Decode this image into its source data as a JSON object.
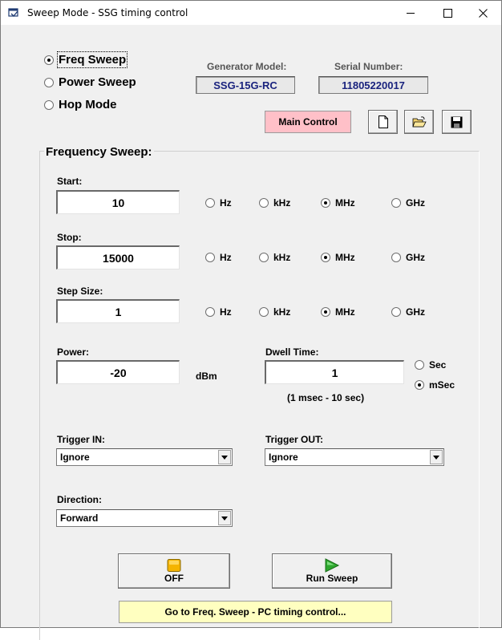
{
  "window": {
    "title": "Sweep Mode - SSG timing control"
  },
  "modes": [
    {
      "label": "Freq Sweep",
      "selected": true
    },
    {
      "label": "Power Sweep",
      "selected": false
    },
    {
      "label": "Hop Mode",
      "selected": false
    }
  ],
  "generator": {
    "model_label": "Generator Model:",
    "model_value": "SSG-15G-RC",
    "serial_label": "Serial Number:",
    "serial_value": "11805220017"
  },
  "toolbar": {
    "main_control_label": "Main Control",
    "main_control_color": "#ffc0c8"
  },
  "group": {
    "title": "Frequency Sweep:"
  },
  "start": {
    "label": "Start:",
    "value": "10",
    "unit_selected": "MHz"
  },
  "stop": {
    "label": "Stop:",
    "value": "15000",
    "unit_selected": "MHz"
  },
  "step": {
    "label": "Step Size:",
    "value": "1",
    "unit_selected": "MHz"
  },
  "units": [
    "Hz",
    "kHz",
    "MHz",
    "GHz"
  ],
  "power": {
    "label": "Power:",
    "value": "-20",
    "unit": "dBm"
  },
  "dwell": {
    "label": "Dwell Time:",
    "value": "1",
    "range_note": "(1 msec - 10 sec)",
    "unit_sec": "Sec",
    "unit_msec": "mSec",
    "unit_selected": "mSec"
  },
  "trigger_in": {
    "label": "Trigger IN:",
    "value": "Ignore"
  },
  "trigger_out": {
    "label": "Trigger OUT:",
    "value": "Ignore"
  },
  "direction": {
    "label": "Direction:",
    "value": "Forward"
  },
  "actions": {
    "off_label": "OFF",
    "run_label": "Run Sweep",
    "goto_label": "Go to Freq. Sweep - PC timing control...",
    "goto_color": "#ffffc0"
  }
}
